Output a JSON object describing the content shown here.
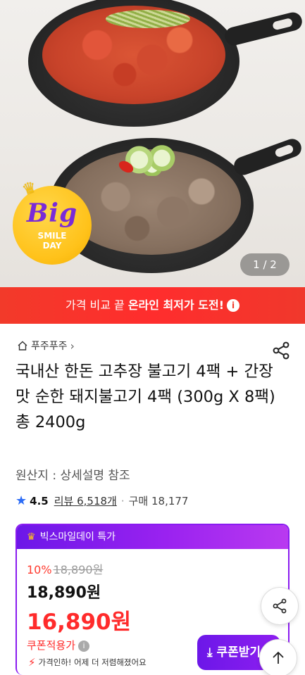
{
  "hero": {
    "pager": "1 / 2",
    "badge": {
      "big": "Big",
      "line1": "SMILE",
      "line2": "DAY"
    }
  },
  "banner": {
    "text_normal": "가격 비교 끝 ",
    "text_bold": "온라인 최저가 도전!",
    "info_icon": "info-icon"
  },
  "store": {
    "name": "푸주푸주",
    "icon": "home-icon",
    "chevron": "›"
  },
  "product": {
    "title": "국내산 한돈 고추장 불고기 4팩 + 간장맛 순한 돼지불고기 4팩 (300g X 8팩) 총 2400g",
    "origin": "원산지 : 상세설명 참조",
    "rating": "4.5",
    "reviews": "리뷰 6,518개",
    "purchases": "구매 18,177"
  },
  "deal": {
    "header": "빅스마일데이 특가",
    "discount_pct": "10%",
    "original_price": "18,890원",
    "price": "18,890원",
    "coupon_price": "16,890원",
    "coupon_label": "쿠폰적용가",
    "price_drop": "가격인하! 어제 더 저렴해졌어요",
    "coupon_button": "쿠폰받기"
  },
  "colors": {
    "accent_purple": "#8a1bf0",
    "sale_red": "#ff2b2b",
    "banner_red": "#f23a2a",
    "rating_blue": "#2c6cf6"
  }
}
